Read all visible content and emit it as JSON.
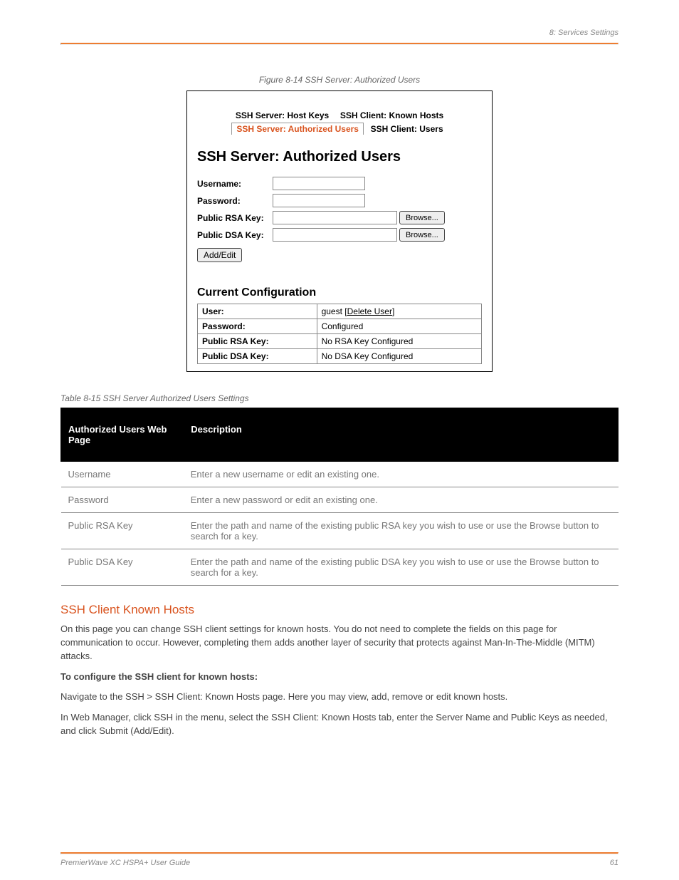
{
  "header": {
    "left": "",
    "right": "8: Services Settings"
  },
  "figure_caption": "Figure 8-14 SSH Server: Authorized Users",
  "ui": {
    "tabs": {
      "row1": {
        "left": "SSH Server: Host Keys",
        "right": "SSH Client: Known Hosts"
      },
      "row2": {
        "active": "SSH Server: Authorized Users",
        "right": "SSH Client: Users"
      }
    },
    "heading": "SSH Server: Authorized Users",
    "form": {
      "username_label": "Username:",
      "password_label": "Password:",
      "rsa_label": "Public RSA Key:",
      "dsa_label": "Public DSA Key:",
      "browse_label": "Browse...",
      "submit_label": "Add/Edit"
    },
    "config_heading": "Current Configuration",
    "config_rows": {
      "user_k": "User:",
      "user_v_name": "guest",
      "user_v_action": "Delete User",
      "password_k": "Password:",
      "password_v": "Configured",
      "rsa_k": "Public RSA Key:",
      "rsa_v": "No RSA Key Configured",
      "dsa_k": "Public DSA Key:",
      "dsa_v": "No DSA Key Configured"
    }
  },
  "settings_caption": "Table 8-15 SSH Server Authorized Users Settings",
  "settings_table": {
    "head1": "Authorized Users Web Page",
    "head2": "Description",
    "rows": [
      {
        "k": "Username",
        "v": "Enter a new username or edit an existing one."
      },
      {
        "k": "Password",
        "v": "Enter a new password or edit an existing one."
      },
      {
        "k": "Public RSA Key",
        "v": "Enter the path and name of the existing public RSA key you wish to use or use the Browse button to search for a key."
      },
      {
        "k": "Public DSA Key",
        "v": "Enter the path and name of the existing public DSA key you wish to use or use the Browse button to search for a key."
      }
    ]
  },
  "section": {
    "heading": "SSH Client Known Hosts",
    "p1": "On this page you can change SSH client settings for known hosts. You do not need to complete the fields on this page for communication to occur. However, completing them adds another layer of security that protects against Man-In-The-Middle (MITM) attacks.",
    "p2_label": "To configure the SSH client for known hosts:",
    "p3": "Navigate to the SSH > SSH Client: Known Hosts page. Here you may view, add, remove or edit known hosts.",
    "p4": "In Web Manager, click SSH in the menu, select the SSH Client: Known Hosts tab, enter the Server Name and Public Keys as needed, and click Submit (Add/Edit)."
  },
  "footer": {
    "left": "PremierWave XC HSPA+ User Guide",
    "right": "61"
  }
}
